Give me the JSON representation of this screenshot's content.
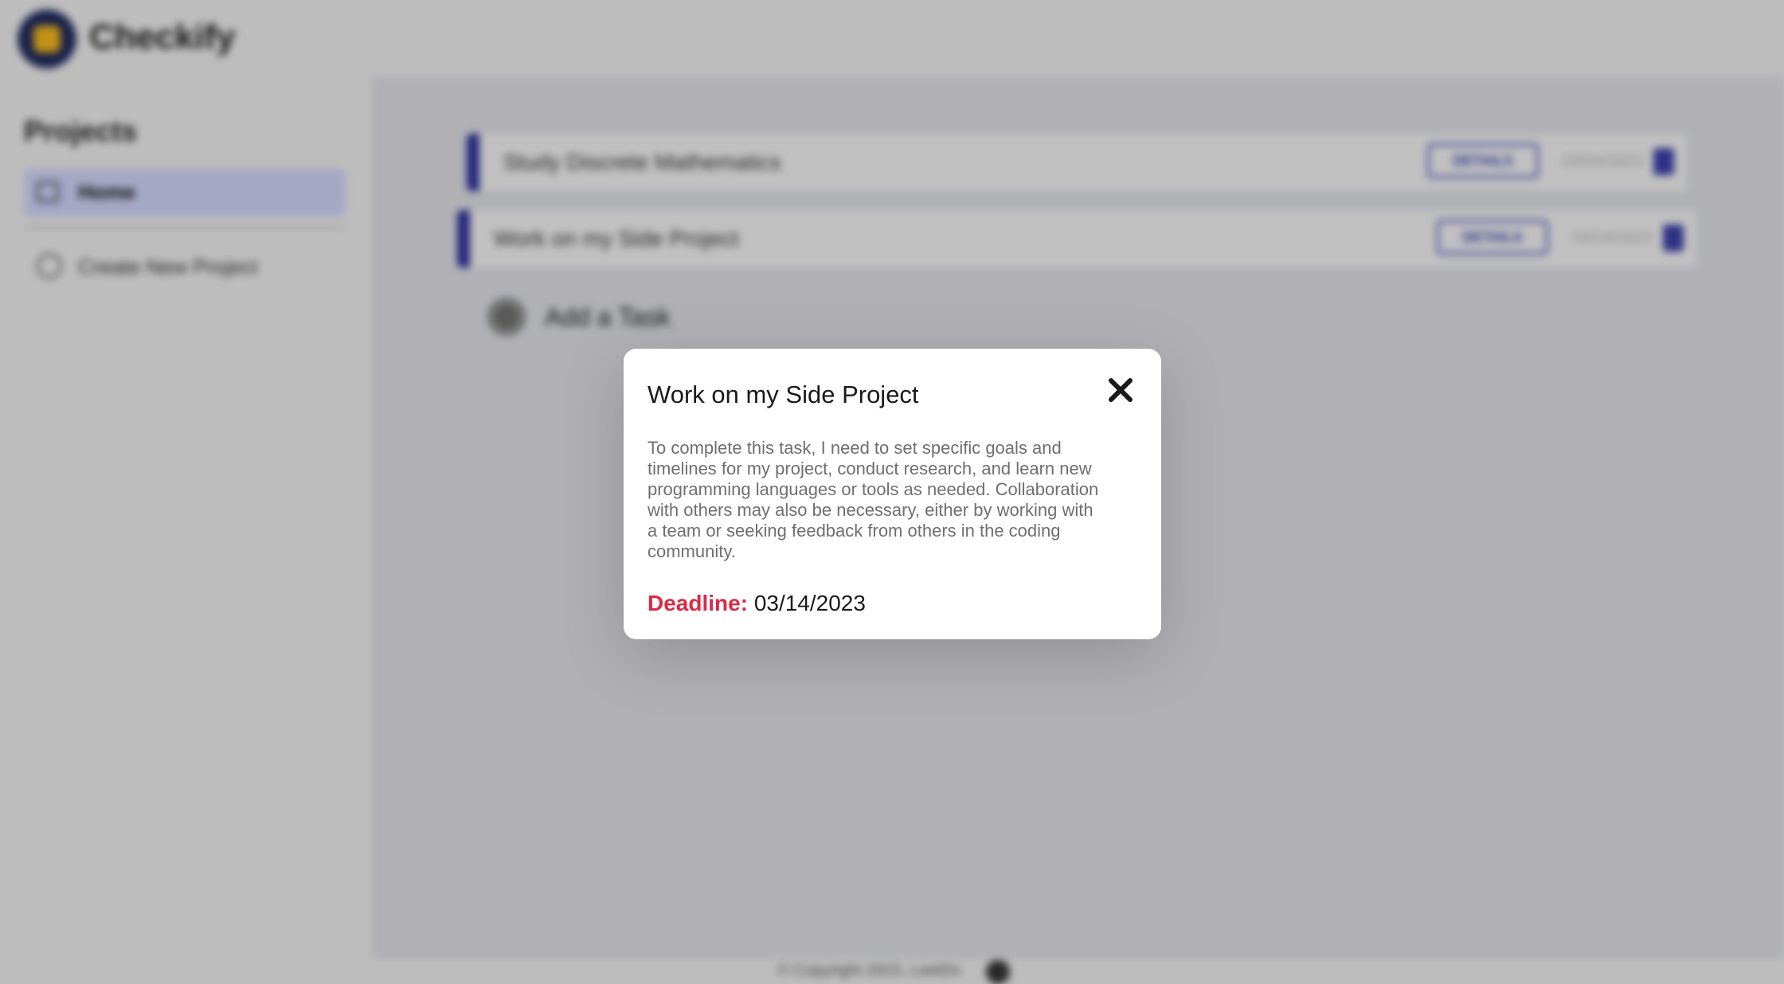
{
  "app": {
    "brand": "Checkify"
  },
  "sidebar": {
    "title": "Projects",
    "items": [
      {
        "label": "Home"
      },
      {
        "label": "Create New Project"
      }
    ]
  },
  "main": {
    "tasks": [
      {
        "title": "Study Discrete Mathematics",
        "details_label": "DETAILS",
        "date": "03/04/2023"
      },
      {
        "title": "Work on my Side Project",
        "details_label": "DETAILS",
        "date": "03/14/2023"
      }
    ],
    "add_task_label": "Add a Task"
  },
  "footer": {
    "text": "© Copyright 2023, LeetDx"
  },
  "modal": {
    "title": "Work on my Side Project",
    "description": "To complete this task, I need to set specific goals and timelines for my project, conduct research, and learn new programming languages or tools as needed. Collaboration with others may also be necessary, either by working with a team or seeking feedback from others in the coding community.",
    "deadline_label": "Deadline:",
    "deadline_value": "03/14/2023"
  },
  "colors": {
    "accent": "#2c2f9a",
    "deadline": "#dc2948",
    "brand_yellow": "#f1b51d"
  },
  "icons": [
    "home-icon",
    "plus-circle-icon",
    "trash-icon",
    "close-icon",
    "github-icon"
  ]
}
